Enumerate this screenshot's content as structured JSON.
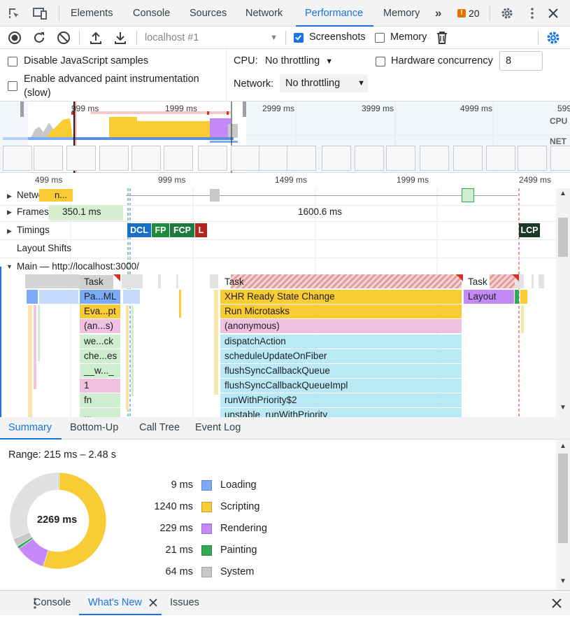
{
  "top_tabs": [
    {
      "label": "Elements"
    },
    {
      "label": "Console"
    },
    {
      "label": "Sources"
    },
    {
      "label": "Network"
    },
    {
      "label": "Performance",
      "active": true
    },
    {
      "label": "Memory"
    }
  ],
  "issues_count": "20",
  "toolbar": {
    "profile_select": "localhost #1",
    "screenshots_label": "Screenshots",
    "screenshots_checked": true,
    "memory_label": "Memory",
    "memory_checked": false
  },
  "settings": {
    "disable_js_samples": "Disable JavaScript samples",
    "advanced_paint_1": "Enable advanced paint instrumentation",
    "advanced_paint_2": "(slow)",
    "cpu_label": "CPU:",
    "cpu_value": "No throttling",
    "network_label": "Network:",
    "network_value": "No throttling",
    "hw_label": "Hardware concurrency",
    "hw_value": "8"
  },
  "overview": {
    "ticks": [
      "999 ms",
      "1999 ms",
      "2999 ms",
      "3999 ms",
      "4999 ms",
      "599"
    ],
    "cpu_label": "CPU",
    "net_label": "NET"
  },
  "timeline": {
    "ticks": [
      "499 ms",
      "999 ms",
      "1499 ms",
      "1999 ms",
      "2499 ms"
    ],
    "tracks": {
      "network": "Network",
      "network_item": "n...",
      "frames": "Frames",
      "frame1": "350.1 ms",
      "frame2": "1600.6 ms",
      "timings": "Timings",
      "layout_shifts": "Layout Shifts",
      "main": "Main — http://localhost:3000/"
    },
    "markers": {
      "dcl": "DCL",
      "fp": "FP",
      "fcp": "FCP",
      "l": "L",
      "lcp": "LCP"
    },
    "flame_left": [
      "Task",
      "Pa...ML",
      "Eva...pt",
      "(an...s)",
      "we...ck",
      "che...es",
      "__w..._",
      "1",
      "fn",
      "..."
    ],
    "flame_mid": [
      "Task",
      "XHR Ready State Change",
      "Run Microtasks",
      "(anonymous)",
      "dispatchAction",
      "scheduleUpdateOnFiber",
      "flushSyncCallbackQueue",
      "flushSyncCallbackQueueImpl",
      "runWithPriority$2",
      "unstable_runWithPriority"
    ],
    "flame_right": [
      "Task",
      "Layout"
    ]
  },
  "bottom_tabs": [
    {
      "label": "Summary",
      "active": true
    },
    {
      "label": "Bottom-Up"
    },
    {
      "label": "Call Tree"
    },
    {
      "label": "Event Log"
    }
  ],
  "summary": {
    "range": "Range: 215 ms – 2.48 s",
    "total": "2269 ms",
    "rows": [
      {
        "value": "9 ms",
        "label": "Loading",
        "color": "#7baaf7"
      },
      {
        "value": "1240 ms",
        "label": "Scripting",
        "color": "#f9cb34"
      },
      {
        "value": "229 ms",
        "label": "Rendering",
        "color": "#c58af9"
      },
      {
        "value": "21 ms",
        "label": "Painting",
        "color": "#34a853"
      },
      {
        "value": "64 ms",
        "label": "System",
        "color": "#c8c8c8"
      }
    ]
  },
  "drawer": {
    "tabs": [
      {
        "label": "Console"
      },
      {
        "label": "What's New",
        "active": true
      },
      {
        "label": "Issues"
      }
    ]
  },
  "colors": {
    "accent": "#1a73e8",
    "scripting": "#f9cb34",
    "rendering": "#c58af9",
    "painting": "#34a853",
    "loading": "#7baaf7",
    "system": "#c8c8c8",
    "idle": "#e0e0e0",
    "task": "#d0d0d0",
    "xhr": "#f9cb34",
    "flame_cyan": "#b8e9f5",
    "flame_pink": "#f0c0e0",
    "flame_green": "#cfeecf"
  }
}
